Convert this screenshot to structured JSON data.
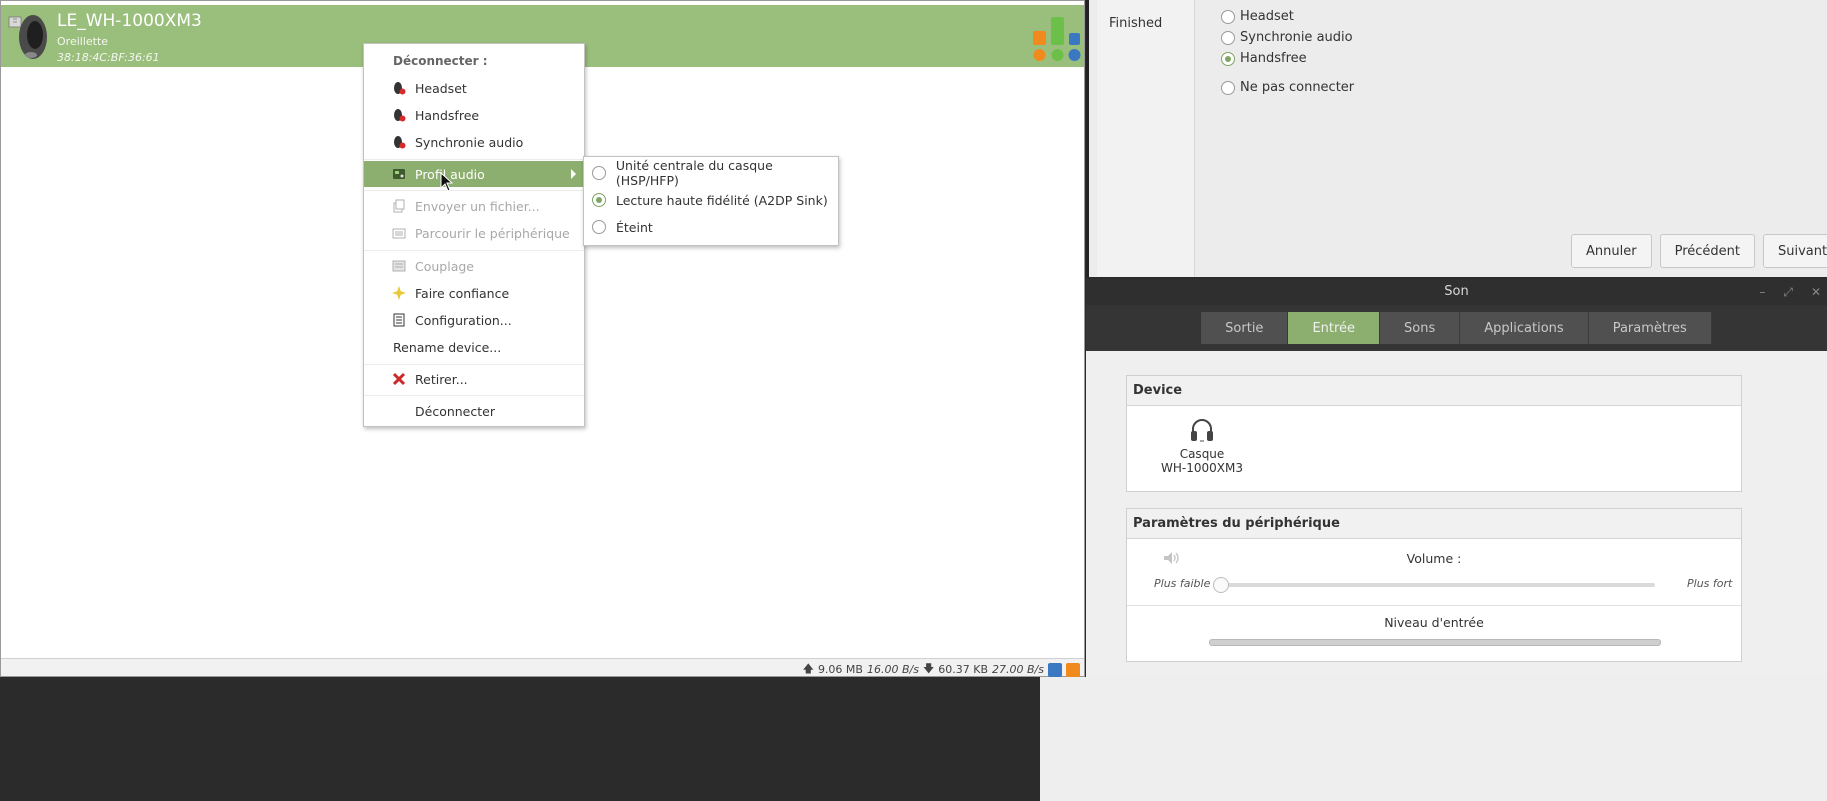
{
  "blueman": {
    "device_name": "LE_WH-1000XM3",
    "device_type": "Oreillette",
    "device_address": "38:18:4C:BF:36:61",
    "status": {
      "upload_total": "9.06 MB",
      "upload_rate": "16.00 B/s",
      "download_total": "60.37 KB",
      "download_rate": "27.00 B/s"
    }
  },
  "context_menu": {
    "header": "Déconnecter :",
    "items": [
      {
        "label": "Headset",
        "icon": "headset-disconnect-icon",
        "enabled": true
      },
      {
        "label": "Handsfree",
        "icon": "headset-disconnect-icon",
        "enabled": true
      },
      {
        "label": "Synchronie audio",
        "icon": "headset-disconnect-icon",
        "enabled": true
      },
      {
        "label": "Profil audio",
        "icon": "audio-card-icon",
        "enabled": true,
        "hovered": true,
        "has_submenu": true
      },
      {
        "label": "Envoyer un fichier...",
        "icon": "send-file-icon",
        "enabled": false
      },
      {
        "label": "Parcourir le périphérique",
        "icon": "browse-icon",
        "enabled": false
      },
      {
        "label": "Couplage",
        "icon": "pair-icon",
        "enabled": false
      },
      {
        "label": "Faire confiance",
        "icon": "star-icon",
        "enabled": true
      },
      {
        "label": "Configuration...",
        "icon": "config-icon",
        "enabled": true
      },
      {
        "label": "Rename device...",
        "enabled": true
      },
      {
        "label": "Retirer...",
        "icon": "remove-icon",
        "enabled": true
      },
      {
        "label": "Déconnecter",
        "enabled": true
      }
    ]
  },
  "submenu": {
    "options": [
      {
        "label": "Unité centrale du casque (HSP/HFP)",
        "selected": false
      },
      {
        "label": "Lecture haute fidélité (A2DP Sink)",
        "selected": true
      },
      {
        "label": "Éteint",
        "selected": false
      }
    ]
  },
  "wizard": {
    "steps": [
      "Finished"
    ],
    "options": [
      {
        "label": "Headset",
        "selected": false
      },
      {
        "label": "Synchronie audio",
        "selected": false
      },
      {
        "label": "Handsfree",
        "selected": true
      },
      {
        "label": "Ne pas connecter",
        "selected": false
      }
    ],
    "buttons": {
      "cancel": "Annuler",
      "previous": "Précédent",
      "next": "Suivant"
    }
  },
  "sound": {
    "title": "Son",
    "tabs": [
      "Sortie",
      "Entrée",
      "Sons",
      "Applications",
      "Paramètres"
    ],
    "active_tab": "Entrée",
    "device_section": "Device",
    "device_label_line1": "Casque",
    "device_label_line2": "WH-1000XM3",
    "params_section": "Paramètres du périphérique",
    "volume_label": "Volume :",
    "volume_min_label": "Plus faible",
    "volume_max_label": "Plus fort",
    "volume_level": 0.0,
    "input_level_label": "Niveau d'entrée",
    "input_level": 0.0
  },
  "colors": {
    "accent_green": "#8cae6e",
    "header_green": "#9abf7c",
    "dark_bar": "#2f2f2f"
  }
}
